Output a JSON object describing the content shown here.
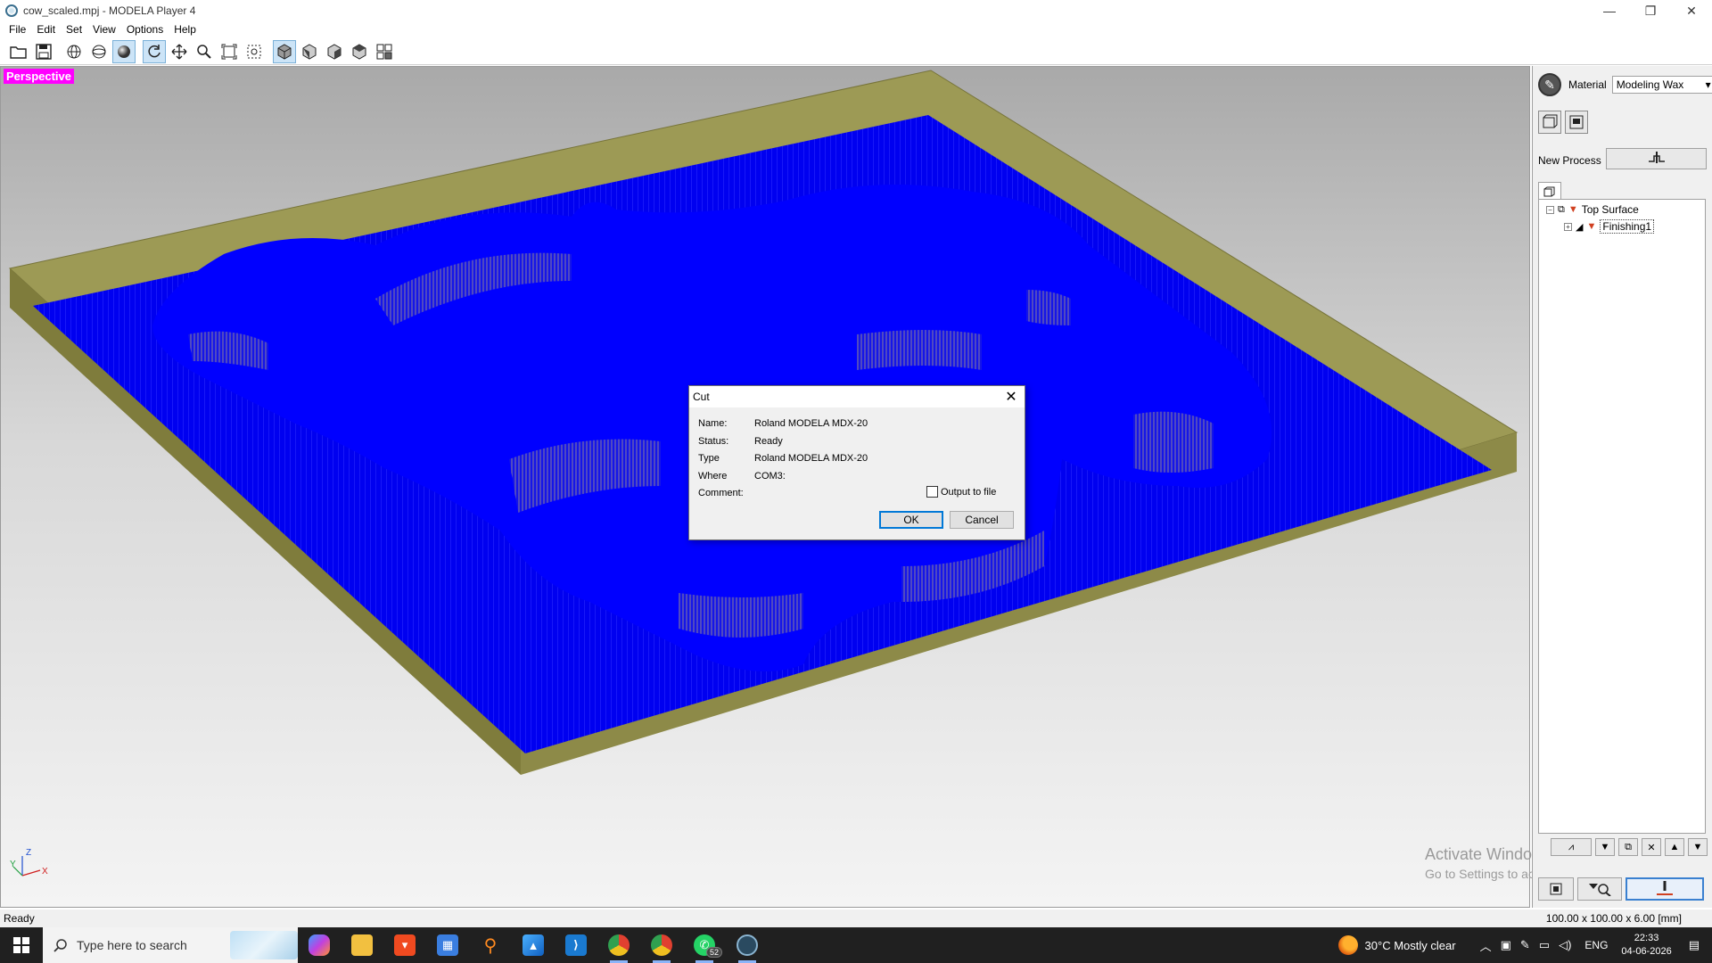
{
  "window": {
    "title": "cow_scaled.mpj - MODELA Player 4",
    "minimize": "—",
    "maximize": "❐",
    "close": "✕"
  },
  "menu": [
    "File",
    "Edit",
    "Set",
    "View",
    "Options",
    "Help"
  ],
  "toolbar_icons": [
    "open-folder-icon",
    "save-icon",
    "wireframe-sphere-icon",
    "sphere-outline-icon",
    "shaded-sphere-icon",
    "rotate-icon",
    "pan-icon",
    "zoom-icon",
    "fit-view-icon",
    "zoom-box-icon",
    "view-iso-icon",
    "view-front-icon",
    "view-side-icon",
    "view-top-icon",
    "view-multi-icon"
  ],
  "viewport": {
    "label": "Perspective",
    "axis": {
      "z": "Z",
      "y": "Y",
      "x": "X"
    }
  },
  "right_panel": {
    "material_label": "Material",
    "material_value": "Modeling Wax",
    "new_process_label": "New Process",
    "tree": {
      "root": "Top Surface",
      "child": "Finishing1"
    }
  },
  "watermark": {
    "title": "Activate Windows",
    "subtitle": "Go to Settings to activate Windows."
  },
  "status": {
    "left": "Ready",
    "dims": "100.00 x 100.00 x 6.00 [mm]"
  },
  "dialog": {
    "title": "Cut",
    "close": "✕",
    "fields": [
      {
        "key": "Name:",
        "value": "Roland MODELA MDX-20"
      },
      {
        "key": "Status:",
        "value": "Ready"
      },
      {
        "key": "Type",
        "value": "Roland MODELA MDX-20"
      },
      {
        "key": "Where",
        "value": "COM3:"
      },
      {
        "key": "Comment:",
        "value": ""
      }
    ],
    "output_to_file": "Output to file",
    "ok": "OK",
    "cancel": "Cancel"
  },
  "taskbar": {
    "search_placeholder": "Type here to search",
    "whatsapp_badge": "52",
    "weather": "30°C  Mostly clear",
    "language": "ENG",
    "time": "22:33",
    "date": "04-06-2026"
  },
  "colors": {
    "toolpath_blue": "#0000ff",
    "stock_olive": "#9a9650",
    "label_magenta": "#ff00ff"
  }
}
